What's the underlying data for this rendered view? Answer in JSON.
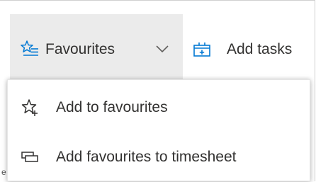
{
  "toolbar": {
    "favourites_label": "Favourites",
    "add_tasks_label": "Add tasks"
  },
  "menu": {
    "items": [
      {
        "label": "Add to favourites",
        "icon": "star-add-icon"
      },
      {
        "label": "Add favourites to timesheet",
        "icon": "timesheet-icon"
      }
    ]
  },
  "colors": {
    "text": "#323130",
    "button_active_bg": "#ebebeb",
    "icon_accent": "#0078d4"
  }
}
